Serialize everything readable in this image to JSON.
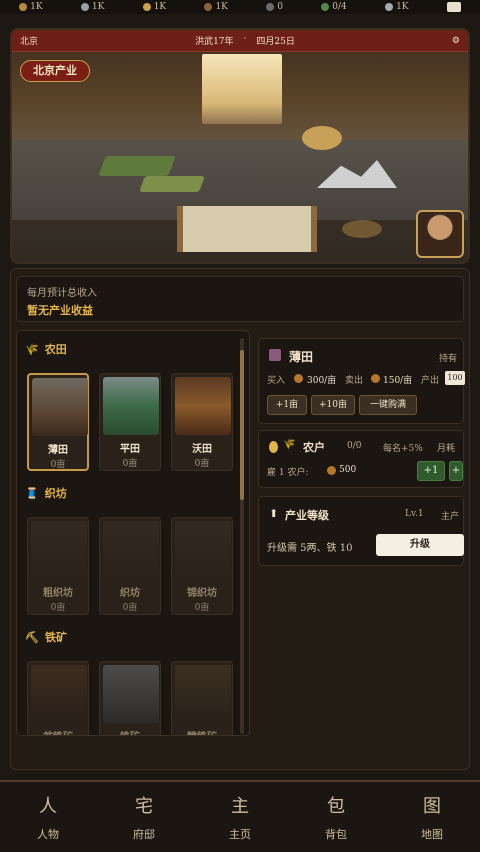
{
  "topbar": {
    "resources": [
      {
        "icon": "coin-icon",
        "value": "1K"
      },
      {
        "icon": "silver-icon",
        "value": "1K"
      },
      {
        "icon": "grain-icon",
        "value": "1K"
      },
      {
        "icon": "wood-icon",
        "value": "1K"
      },
      {
        "icon": "iron-icon",
        "value": "0"
      },
      {
        "icon": "people-icon",
        "value": "0/4"
      },
      {
        "icon": "sword-icon",
        "value": "1K"
      }
    ]
  },
  "hero": {
    "location": "北京",
    "year": "洪武17年",
    "date": "四月25日",
    "tag": "北京产业"
  },
  "income": {
    "label": "每月预计总收入",
    "value": "暂无产业收益"
  },
  "categories": [
    {
      "name": "农田",
      "icon": "farm-icon",
      "items": [
        {
          "name": "薄田",
          "count": "0亩"
        },
        {
          "name": "平田",
          "count": "0亩"
        },
        {
          "name": "沃田",
          "count": "0亩"
        }
      ]
    },
    {
      "name": "织坊",
      "icon": "loom-icon",
      "items": [
        {
          "name": "粗织坊",
          "count": "0亩"
        },
        {
          "name": "织坊",
          "count": "0亩"
        },
        {
          "name": "锦织坊",
          "count": "0亩"
        }
      ]
    },
    {
      "name": "铁矿",
      "icon": "pickaxe-icon",
      "items": [
        {
          "name": "贫铁矿",
          "count": ""
        },
        {
          "name": "铁矿",
          "count": ""
        },
        {
          "name": "精铁矿",
          "count": ""
        }
      ]
    }
  ],
  "detail": {
    "title": "薄田",
    "status": "持有",
    "buy_label": "买入",
    "buy_price": "300/亩",
    "sell_label": "卖出",
    "sell_price": "150/亩",
    "yield_label": "产出",
    "yield_value": "100",
    "buttons": [
      "+1亩",
      "+10亩",
      "一键购满"
    ]
  },
  "farmer": {
    "title": "农户",
    "count": "0/0",
    "bonus": "每名+5%",
    "monthly": "月耗",
    "hire_label": "雇 1 农户:",
    "hire_cost": "500",
    "btn_plus1": "+1",
    "btn_plus": "+"
  },
  "upgrade": {
    "title": "产业等级",
    "level": "Lv.1",
    "main": "主产",
    "req": "升级需 5两、铁 10",
    "button": "升级"
  },
  "nav": [
    {
      "glyph": "人",
      "label": "人物"
    },
    {
      "glyph": "宅",
      "label": "府邸"
    },
    {
      "glyph": "主",
      "label": "主页"
    },
    {
      "glyph": "包",
      "label": "背包"
    },
    {
      "glyph": "图",
      "label": "地图"
    }
  ]
}
